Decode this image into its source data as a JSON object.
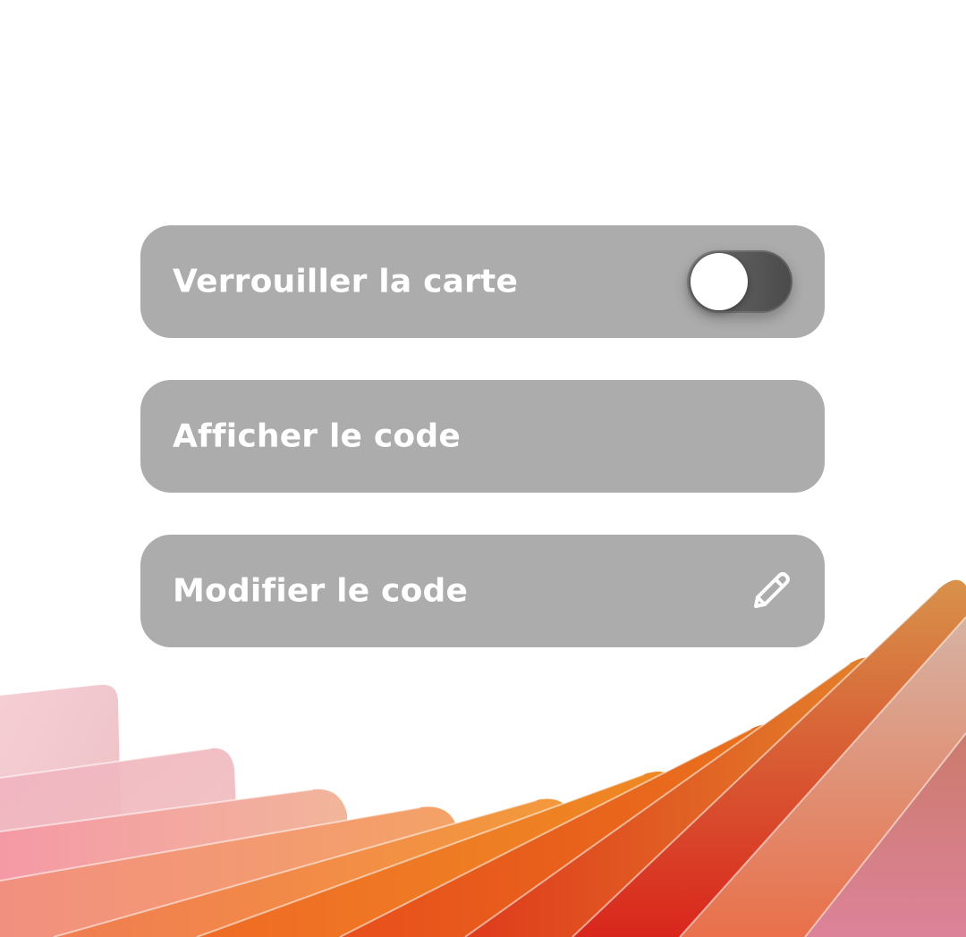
{
  "settings": {
    "lock_card": {
      "label": "Verrouiller la carte",
      "toggle_on": false
    },
    "show_code": {
      "label": "Afficher le code"
    },
    "edit_code": {
      "label": "Modifier le code",
      "icon": "pencil-icon"
    }
  },
  "colors": {
    "background": "#ffffff",
    "panel": "#acacac",
    "text": "#ffffff",
    "toggle_track": "#555555",
    "toggle_knob": "#ffffff",
    "accent_orange": "#ef6a1f",
    "accent_red": "#d9261c",
    "accent_pink": "#f2a9b6"
  }
}
